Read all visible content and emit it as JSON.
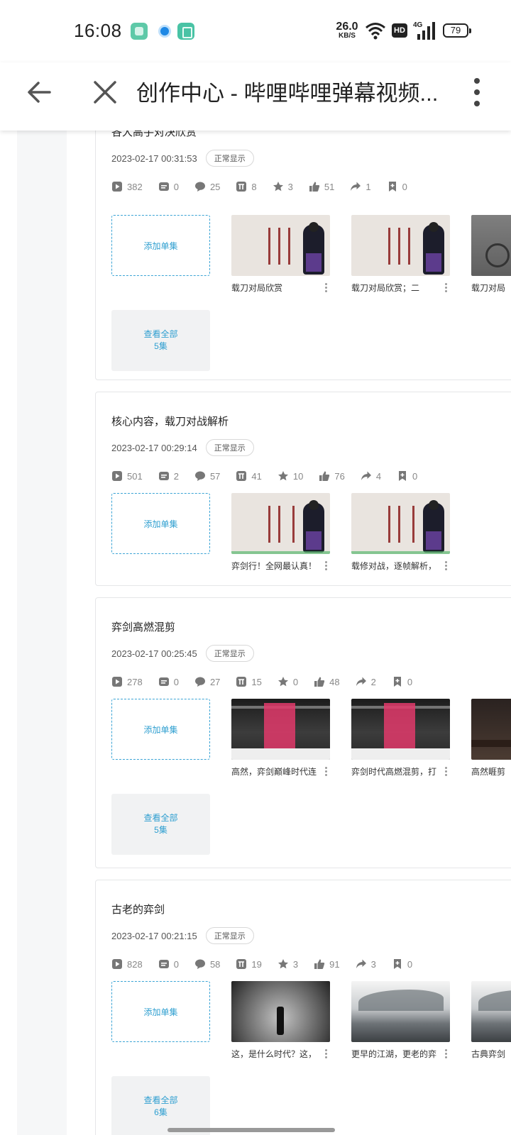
{
  "status_bar": {
    "time": "16:08",
    "net_speed_value": "26.0",
    "net_speed_unit": "KB/S",
    "hd_label": "HD",
    "network": "4G",
    "battery": "79"
  },
  "header": {
    "title": "创作中心 - 哔哩哔哩弹幕视频..."
  },
  "cards": [
    {
      "title": "各大高手对决欣赏",
      "date": "2023-02-17 00:31:53",
      "status": "正常显示",
      "stats": {
        "plays": "382",
        "danmaku": "0",
        "comments": "25",
        "coins": "8",
        "favorites": "3",
        "likes": "51",
        "shares": "1",
        "bookmarks": "0"
      },
      "add_label": "添加单集",
      "episodes": [
        {
          "title": "载刀对局欣赏"
        },
        {
          "title": "载刀对局欣赏；二"
        },
        {
          "title": "载刀对局"
        }
      ],
      "view_all": {
        "label": "查看全部",
        "count": "5集"
      }
    },
    {
      "title": "核心内容，载刀对战解析",
      "date": "2023-02-17 00:29:14",
      "status": "正常显示",
      "stats": {
        "plays": "501",
        "danmaku": "2",
        "comments": "57",
        "coins": "41",
        "favorites": "10",
        "likes": "76",
        "shares": "4",
        "bookmarks": "0"
      },
      "add_label": "添加单集",
      "episodes": [
        {
          "title": "弈剑行！全网最认真！"
        },
        {
          "title": "载修对战，逐帧解析，"
        }
      ]
    },
    {
      "title": "弈剑高燃混剪",
      "date": "2023-02-17 00:25:45",
      "status": "正常显示",
      "stats": {
        "plays": "278",
        "danmaku": "0",
        "comments": "27",
        "coins": "15",
        "favorites": "0",
        "likes": "48",
        "shares": "2",
        "bookmarks": "0"
      },
      "add_label": "添加单集",
      "episodes": [
        {
          "title": "高然，弈剑巅峰时代连"
        },
        {
          "title": "弈剑时代高燃混剪，打"
        },
        {
          "title": "高然睚剪"
        }
      ],
      "view_all": {
        "label": "查看全部",
        "count": "5集"
      }
    },
    {
      "title": "古老的弈剑",
      "date": "2023-02-17 00:21:15",
      "status": "正常显示",
      "stats": {
        "plays": "828",
        "danmaku": "0",
        "comments": "58",
        "coins": "19",
        "favorites": "3",
        "likes": "91",
        "shares": "3",
        "bookmarks": "0"
      },
      "add_label": "添加单集",
      "episodes": [
        {
          "title": "这，是什么时代？这，"
        },
        {
          "title": "更早的江湖，更老的弈"
        },
        {
          "title": "古典弈剑"
        }
      ],
      "view_all": {
        "label": "查看全部",
        "count": "6集"
      }
    }
  ]
}
